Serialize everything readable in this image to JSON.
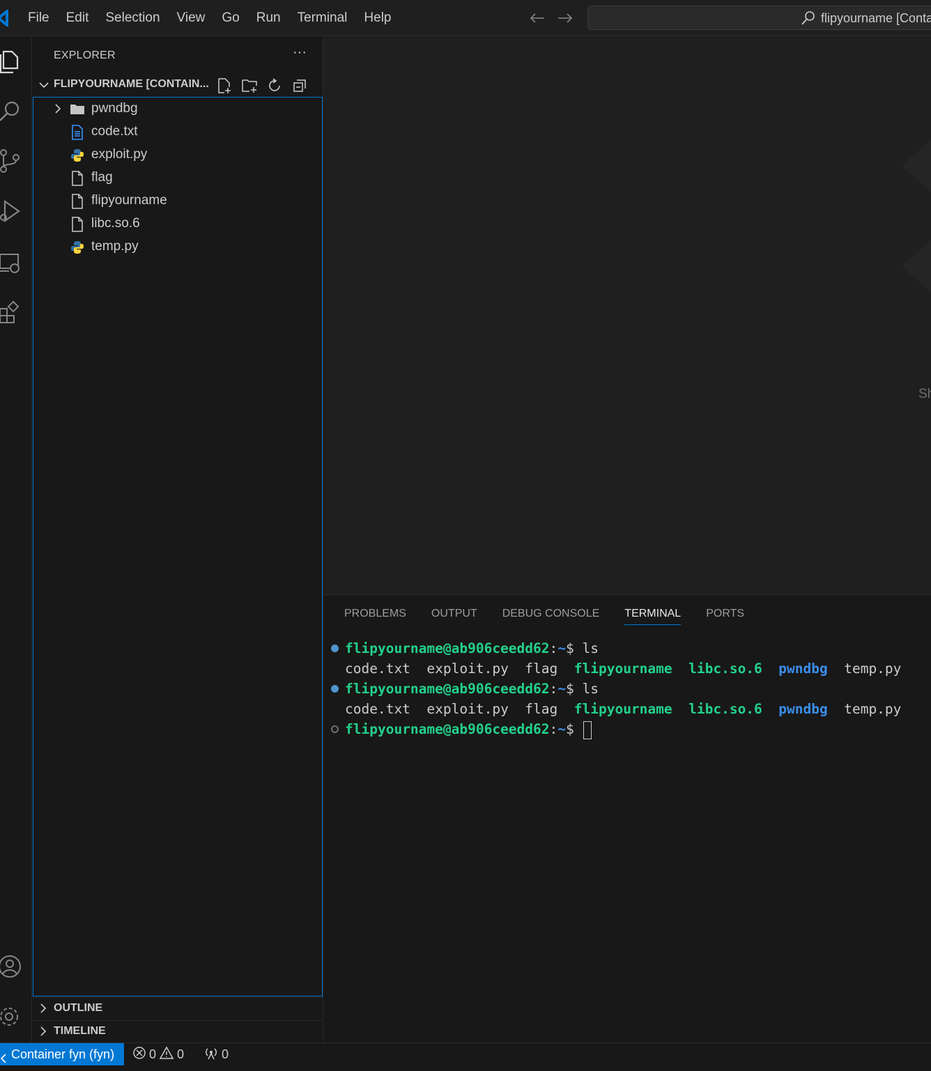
{
  "menu": [
    "File",
    "Edit",
    "Selection",
    "View",
    "Go",
    "Run",
    "Terminal",
    "Help"
  ],
  "command_center": {
    "text": "flipyourname [Container fyn (fyn)]"
  },
  "explorer": {
    "title": "EXPLORER",
    "more": "···",
    "folder_label": "FLIPYOURNAME [CONTAIN...",
    "items": [
      {
        "label": "pwndbg",
        "type": "folder",
        "icon": "folder-icon"
      },
      {
        "label": "code.txt",
        "type": "file",
        "icon": "text-file-icon"
      },
      {
        "label": "exploit.py",
        "type": "file",
        "icon": "python-icon"
      },
      {
        "label": "flag",
        "type": "file",
        "icon": "file-icon"
      },
      {
        "label": "flipyourname",
        "type": "file",
        "icon": "file-icon"
      },
      {
        "label": "libc.so.6",
        "type": "file",
        "icon": "file-icon"
      },
      {
        "label": "temp.py",
        "type": "file",
        "icon": "python-icon"
      }
    ],
    "outline": "OUTLINE",
    "timeline": "TIMELINE"
  },
  "editor": {
    "watermark_text": "Sh"
  },
  "panel": {
    "tabs": [
      "PROBLEMS",
      "OUTPUT",
      "DEBUG CONSOLE",
      "TERMINAL",
      "PORTS"
    ],
    "active_tab": "TERMINAL"
  },
  "terminal": {
    "prompt_user": "flipyourname@ab906ceedd62",
    "prompt_sep": ":",
    "prompt_path": "~",
    "prompt_end": "$ ",
    "command": "ls",
    "listing": {
      "code_txt": "code.txt",
      "exploit_py": "exploit.py",
      "flag": "flag",
      "flipyourname": "flipyourname",
      "libc": "libc.so.6",
      "pwndbg": "pwndbg",
      "temp_py": "temp.py"
    }
  },
  "statusbar": {
    "remote": "Container fyn (fyn)",
    "errors": "0",
    "warnings": "0",
    "ports": "0"
  },
  "colors": {
    "accent": "#0078d4",
    "terminal_green": "#23d18b",
    "terminal_blue": "#3b8eea",
    "python_blue": "#3572a5",
    "python_yellow": "#ffd43b"
  }
}
